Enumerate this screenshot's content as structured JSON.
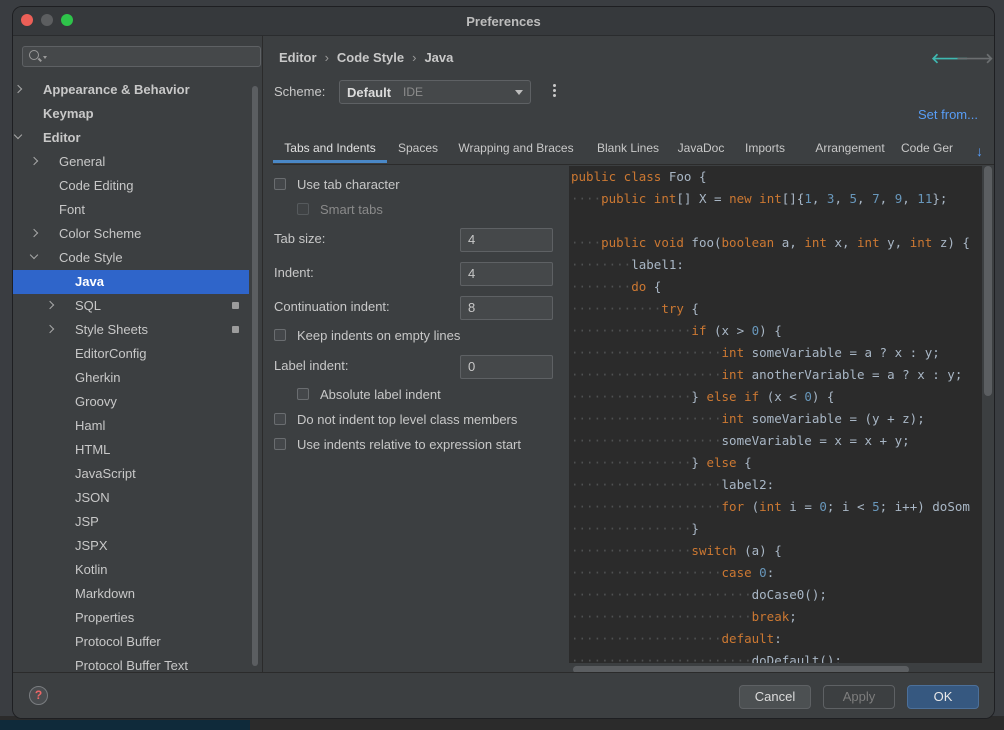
{
  "window": {
    "title": "Preferences"
  },
  "sidebar": {
    "search_placeholder": "",
    "items": [
      {
        "label": "Appearance & Behavior",
        "level": 0,
        "arrow": "right",
        "bold": true
      },
      {
        "label": "Keymap",
        "level": 0,
        "arrow": "none",
        "bold": true
      },
      {
        "label": "Editor",
        "level": 0,
        "arrow": "down",
        "bold": true
      },
      {
        "label": "General",
        "level": 1,
        "arrow": "right"
      },
      {
        "label": "Code Editing",
        "level": 1,
        "arrow": "none"
      },
      {
        "label": "Font",
        "level": 1,
        "arrow": "none"
      },
      {
        "label": "Color Scheme",
        "level": 1,
        "arrow": "right"
      },
      {
        "label": "Code Style",
        "level": 1,
        "arrow": "down"
      },
      {
        "label": "Java",
        "level": 2,
        "arrow": "none",
        "selected": true
      },
      {
        "label": "SQL",
        "level": 2,
        "arrow": "right",
        "badge": true
      },
      {
        "label": "Style Sheets",
        "level": 2,
        "arrow": "right",
        "badge": true
      },
      {
        "label": "EditorConfig",
        "level": 2,
        "arrow": "none"
      },
      {
        "label": "Gherkin",
        "level": 2,
        "arrow": "none"
      },
      {
        "label": "Groovy",
        "level": 2,
        "arrow": "none"
      },
      {
        "label": "Haml",
        "level": 2,
        "arrow": "none"
      },
      {
        "label": "HTML",
        "level": 2,
        "arrow": "none"
      },
      {
        "label": "JavaScript",
        "level": 2,
        "arrow": "none"
      },
      {
        "label": "JSON",
        "level": 2,
        "arrow": "none"
      },
      {
        "label": "JSP",
        "level": 2,
        "arrow": "none"
      },
      {
        "label": "JSPX",
        "level": 2,
        "arrow": "none"
      },
      {
        "label": "Kotlin",
        "level": 2,
        "arrow": "none"
      },
      {
        "label": "Markdown",
        "level": 2,
        "arrow": "none"
      },
      {
        "label": "Properties",
        "level": 2,
        "arrow": "none"
      },
      {
        "label": "Protocol Buffer",
        "level": 2,
        "arrow": "none"
      },
      {
        "label": "Protocol Buffer Text",
        "level": 2,
        "arrow": "none"
      }
    ]
  },
  "breadcrumb": [
    "Editor",
    "Code Style",
    "Java"
  ],
  "nav": {
    "back_icon": "arrow-left-icon",
    "forward_icon": "arrow-right-icon"
  },
  "scheme": {
    "label": "Scheme:",
    "value": "Default",
    "sub": "IDE"
  },
  "set_from": "Set from...",
  "tabs": [
    "Tabs and Indents",
    "Spaces",
    "Wrapping and Braces",
    "Blank Lines",
    "JavaDoc",
    "Imports",
    "Arrangement",
    "Code Ger"
  ],
  "options": {
    "use_tab": "Use tab character",
    "smart_tabs": "Smart tabs",
    "tab_size_label": "Tab size:",
    "tab_size": "4",
    "indent_label": "Indent:",
    "indent": "4",
    "cont_label": "Continuation indent:",
    "cont": "8",
    "keep_indents": "Keep indents on empty lines",
    "label_indent_label": "Label indent:",
    "label_indent": "0",
    "absolute_label": "Absolute label indent",
    "no_indent_top": "Do not indent top level class members",
    "relative_indents": "Use indents relative to expression start"
  },
  "code_lines": [
    [
      [
        "k",
        "public class "
      ],
      [
        "p",
        "Foo {"
      ]
    ],
    [
      [
        "d",
        "····"
      ],
      [
        "k",
        "public int"
      ],
      [
        "p",
        "[] X = "
      ],
      [
        "k",
        "new int"
      ],
      [
        "p",
        "[]{"
      ],
      [
        "n",
        "1"
      ],
      [
        "p",
        ", "
      ],
      [
        "n",
        "3"
      ],
      [
        "p",
        ", "
      ],
      [
        "n",
        "5"
      ],
      [
        "p",
        ", "
      ],
      [
        "n",
        "7"
      ],
      [
        "p",
        ", "
      ],
      [
        "n",
        "9"
      ],
      [
        "p",
        ", "
      ],
      [
        "n",
        "11"
      ],
      [
        "p",
        "};"
      ]
    ],
    [],
    [
      [
        "d",
        "····"
      ],
      [
        "k",
        "public void "
      ],
      [
        "p",
        "foo("
      ],
      [
        "k",
        "boolean "
      ],
      [
        "p",
        "a, "
      ],
      [
        "k",
        "int "
      ],
      [
        "p",
        "x, "
      ],
      [
        "k",
        "int "
      ],
      [
        "p",
        "y, "
      ],
      [
        "k",
        "int "
      ],
      [
        "p",
        "z) {"
      ]
    ],
    [
      [
        "d",
        "········"
      ],
      [
        "p",
        "label1:"
      ]
    ],
    [
      [
        "d",
        "········"
      ],
      [
        "k",
        "do "
      ],
      [
        "p",
        "{"
      ]
    ],
    [
      [
        "d",
        "············"
      ],
      [
        "k",
        "try "
      ],
      [
        "p",
        "{"
      ]
    ],
    [
      [
        "d",
        "················"
      ],
      [
        "k",
        "if "
      ],
      [
        "p",
        "(x > "
      ],
      [
        "n",
        "0"
      ],
      [
        "p",
        ") {"
      ]
    ],
    [
      [
        "d",
        "····················"
      ],
      [
        "k",
        "int "
      ],
      [
        "p",
        "someVariable = a ? x : y;"
      ]
    ],
    [
      [
        "d",
        "····················"
      ],
      [
        "k",
        "int "
      ],
      [
        "p",
        "anotherVariable = a ? x : y;"
      ]
    ],
    [
      [
        "d",
        "················"
      ],
      [
        "p",
        "} "
      ],
      [
        "k",
        "else if "
      ],
      [
        "p",
        "(x < "
      ],
      [
        "n",
        "0"
      ],
      [
        "p",
        ") {"
      ]
    ],
    [
      [
        "d",
        "····················"
      ],
      [
        "k",
        "int "
      ],
      [
        "p",
        "someVariable = (y + z);"
      ]
    ],
    [
      [
        "d",
        "····················"
      ],
      [
        "p",
        "someVariable = x = x + y;"
      ]
    ],
    [
      [
        "d",
        "················"
      ],
      [
        "p",
        "} "
      ],
      [
        "k",
        "else "
      ],
      [
        "p",
        "{"
      ]
    ],
    [
      [
        "d",
        "····················"
      ],
      [
        "p",
        "label2:"
      ]
    ],
    [
      [
        "d",
        "····················"
      ],
      [
        "k",
        "for "
      ],
      [
        "p",
        "("
      ],
      [
        "k",
        "int "
      ],
      [
        "p",
        "i = "
      ],
      [
        "n",
        "0"
      ],
      [
        "p",
        "; i < "
      ],
      [
        "n",
        "5"
      ],
      [
        "p",
        "; i++) doSom"
      ]
    ],
    [
      [
        "d",
        "················"
      ],
      [
        "p",
        "}"
      ]
    ],
    [
      [
        "d",
        "················"
      ],
      [
        "k",
        "switch "
      ],
      [
        "p",
        "(a) {"
      ]
    ],
    [
      [
        "d",
        "····················"
      ],
      [
        "k",
        "case "
      ],
      [
        "n",
        "0"
      ],
      [
        "p",
        ":"
      ]
    ],
    [
      [
        "d",
        "························"
      ],
      [
        "p",
        "doCase0();"
      ]
    ],
    [
      [
        "d",
        "························"
      ],
      [
        "k",
        "break"
      ],
      [
        "p",
        ";"
      ]
    ],
    [
      [
        "d",
        "····················"
      ],
      [
        "k",
        "default"
      ],
      [
        "p",
        ":"
      ]
    ],
    [
      [
        "d",
        "························"
      ],
      [
        "p",
        "doDefault();"
      ]
    ]
  ],
  "footer": {
    "help": "?",
    "cancel": "Cancel",
    "apply": "Apply",
    "ok": "OK"
  },
  "colors": {
    "accent": "#2f65ca",
    "keyword": "#cc7832",
    "number": "#6897bb",
    "text": "#a9b7c6",
    "link": "#589df6"
  }
}
